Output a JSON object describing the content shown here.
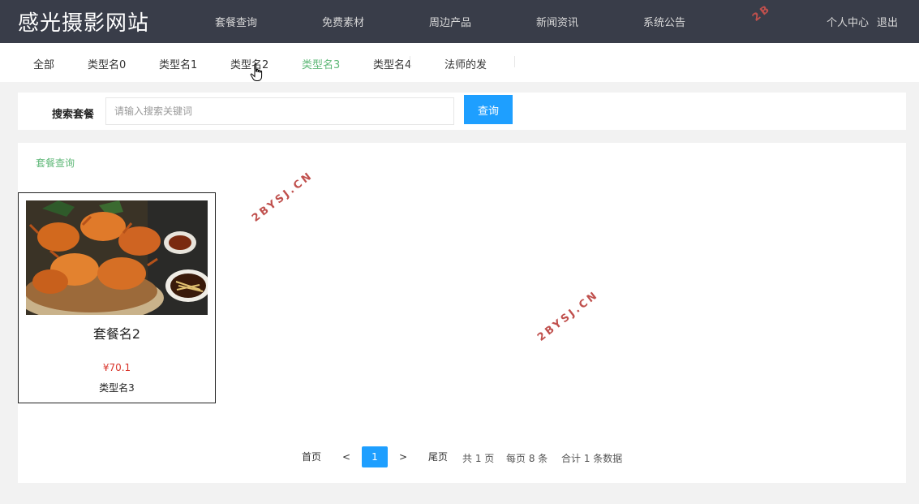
{
  "header": {
    "logo": "感光摄影网站",
    "nav": [
      {
        "label": "套餐查询"
      },
      {
        "label": "免费素材"
      },
      {
        "label": "周边产品"
      },
      {
        "label": "新闻资讯"
      },
      {
        "label": "系统公告"
      }
    ],
    "user_center": "个人中心",
    "logout": "退出"
  },
  "categories": {
    "items": [
      {
        "label": "全部"
      },
      {
        "label": "类型名0"
      },
      {
        "label": "类型名1"
      },
      {
        "label": "类型名2"
      },
      {
        "label": "类型名3"
      },
      {
        "label": "类型名4"
      },
      {
        "label": "法师的发"
      }
    ],
    "active_index": 4
  },
  "search": {
    "label": "搜索套餐",
    "placeholder": "请输入搜索关键词",
    "value": "",
    "button": "查询"
  },
  "section": {
    "title": "套餐查询"
  },
  "products": [
    {
      "name": "套餐名2",
      "price": "¥70.1",
      "type": "类型名3",
      "image": "crab-dish-photo"
    }
  ],
  "pagination": {
    "first": "首页",
    "prev": "<",
    "current": "1",
    "next": ">",
    "last": "尾页",
    "total_pages": "共 1 页",
    "per_page": "每页 8 条",
    "total_records": "合计 1 条数据"
  },
  "watermarks": [
    "2BYSJ.CN",
    "2BYSJ.CN",
    "2B"
  ],
  "colors": {
    "header_bg": "#393d49",
    "accent_green": "#5fb878",
    "primary_blue": "#1e9fff",
    "price_red": "#d9342a"
  }
}
